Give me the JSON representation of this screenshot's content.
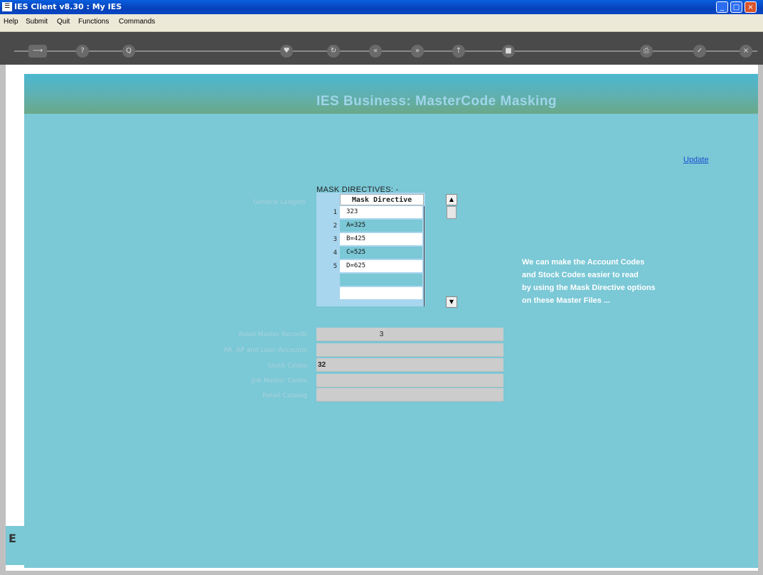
{
  "window": {
    "title": "IES Client v8.30 : My IES",
    "icon": "app-icon",
    "controls": {
      "minimize": "_",
      "maximize": "□",
      "close": "×"
    }
  },
  "menu": {
    "items": [
      "Help",
      "Submit",
      "Quit",
      "Functions",
      "Commands"
    ]
  },
  "toolbar": {
    "icons": [
      "arrow-icon",
      "help-icon",
      "search-icon",
      "heart-icon",
      "refresh-icon",
      "back-icon",
      "forward-icon",
      "up-icon",
      "stop-icon",
      "print-icon",
      "check-icon",
      "close-icon"
    ],
    "glyphs": {
      "help": "?",
      "search": "Q",
      "back": "«",
      "forward": "»",
      "check": "✓",
      "close": "×"
    }
  },
  "page": {
    "title": "IES Business: MasterCode Masking",
    "update_link": "Update",
    "mask_heading": "MASK DIRECTIVES: -",
    "side_stub": "E"
  },
  "mask_grid": {
    "label": "General Ledgers",
    "header": "Mask Directive",
    "rows": [
      {
        "num": "1",
        "value": "323"
      },
      {
        "num": "2",
        "value": "A=325"
      },
      {
        "num": "3",
        "value": "B=425"
      },
      {
        "num": "4",
        "value": "C=525"
      },
      {
        "num": "5",
        "value": "D=625"
      },
      {
        "num": "",
        "value": ""
      },
      {
        "num": "",
        "value": ""
      }
    ],
    "scroll_up": "▲",
    "scroll_down": "▼"
  },
  "info": {
    "lines": [
      "We can make the Account Codes",
      "and Stock Codes easier to read",
      "by using the Mask Directive options",
      "on these Master Files ..."
    ]
  },
  "fields": [
    {
      "label": "Asset Master Records",
      "value": "3"
    },
    {
      "label": "AR, AP and Loan Accounts",
      "value": ""
    },
    {
      "label": "Stock Codes",
      "value": "32"
    },
    {
      "label": "Job Master Codes",
      "value": ""
    },
    {
      "label": "Retail Catalog",
      "value": ""
    }
  ],
  "colors": {
    "content_bg": "#7bc8d6",
    "header_text": "#9fd5ea",
    "link": "#1a4ecf"
  }
}
